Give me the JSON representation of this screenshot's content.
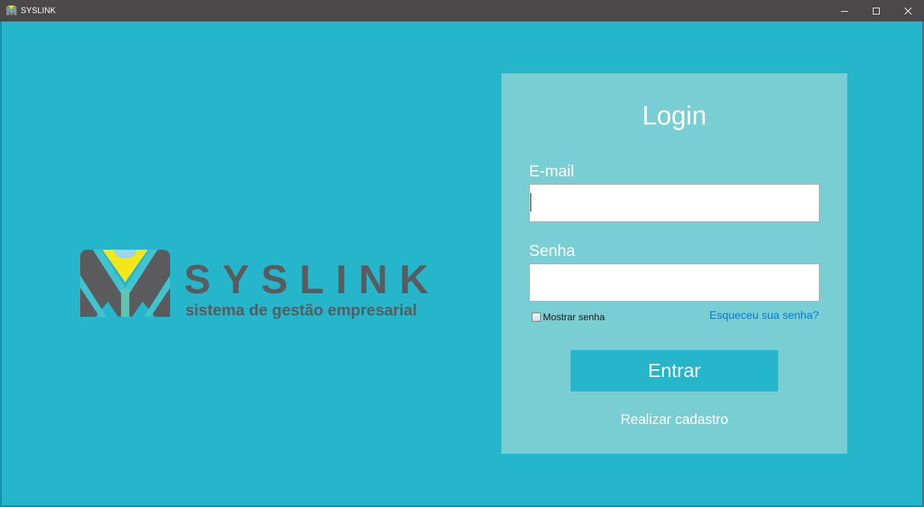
{
  "window": {
    "title": "SYSLINK",
    "icon": "syslink-logo-icon",
    "controls": {
      "minimize": "minimize-icon",
      "maximize": "maximize-icon",
      "close": "close-icon"
    }
  },
  "logo": {
    "wordmark": "SYSLINK",
    "tagline": "sistema de gestão empresarial"
  },
  "login": {
    "title": "Login",
    "email_label": "E-mail",
    "email_value": "",
    "password_label": "Senha",
    "password_value": "",
    "show_password_label": "Mostrar senha",
    "show_password_checked": false,
    "forgot_password": "Esqueceu sua senha?",
    "submit_label": "Entrar",
    "register_link": "Realizar cadastro"
  },
  "colors": {
    "background": "#26b6cb",
    "panel": "#78ced3",
    "titlebar": "#4a4848",
    "logo_gray": "#5b5a5c",
    "logo_yellow": "#f5e619",
    "link": "#0a78c8"
  }
}
